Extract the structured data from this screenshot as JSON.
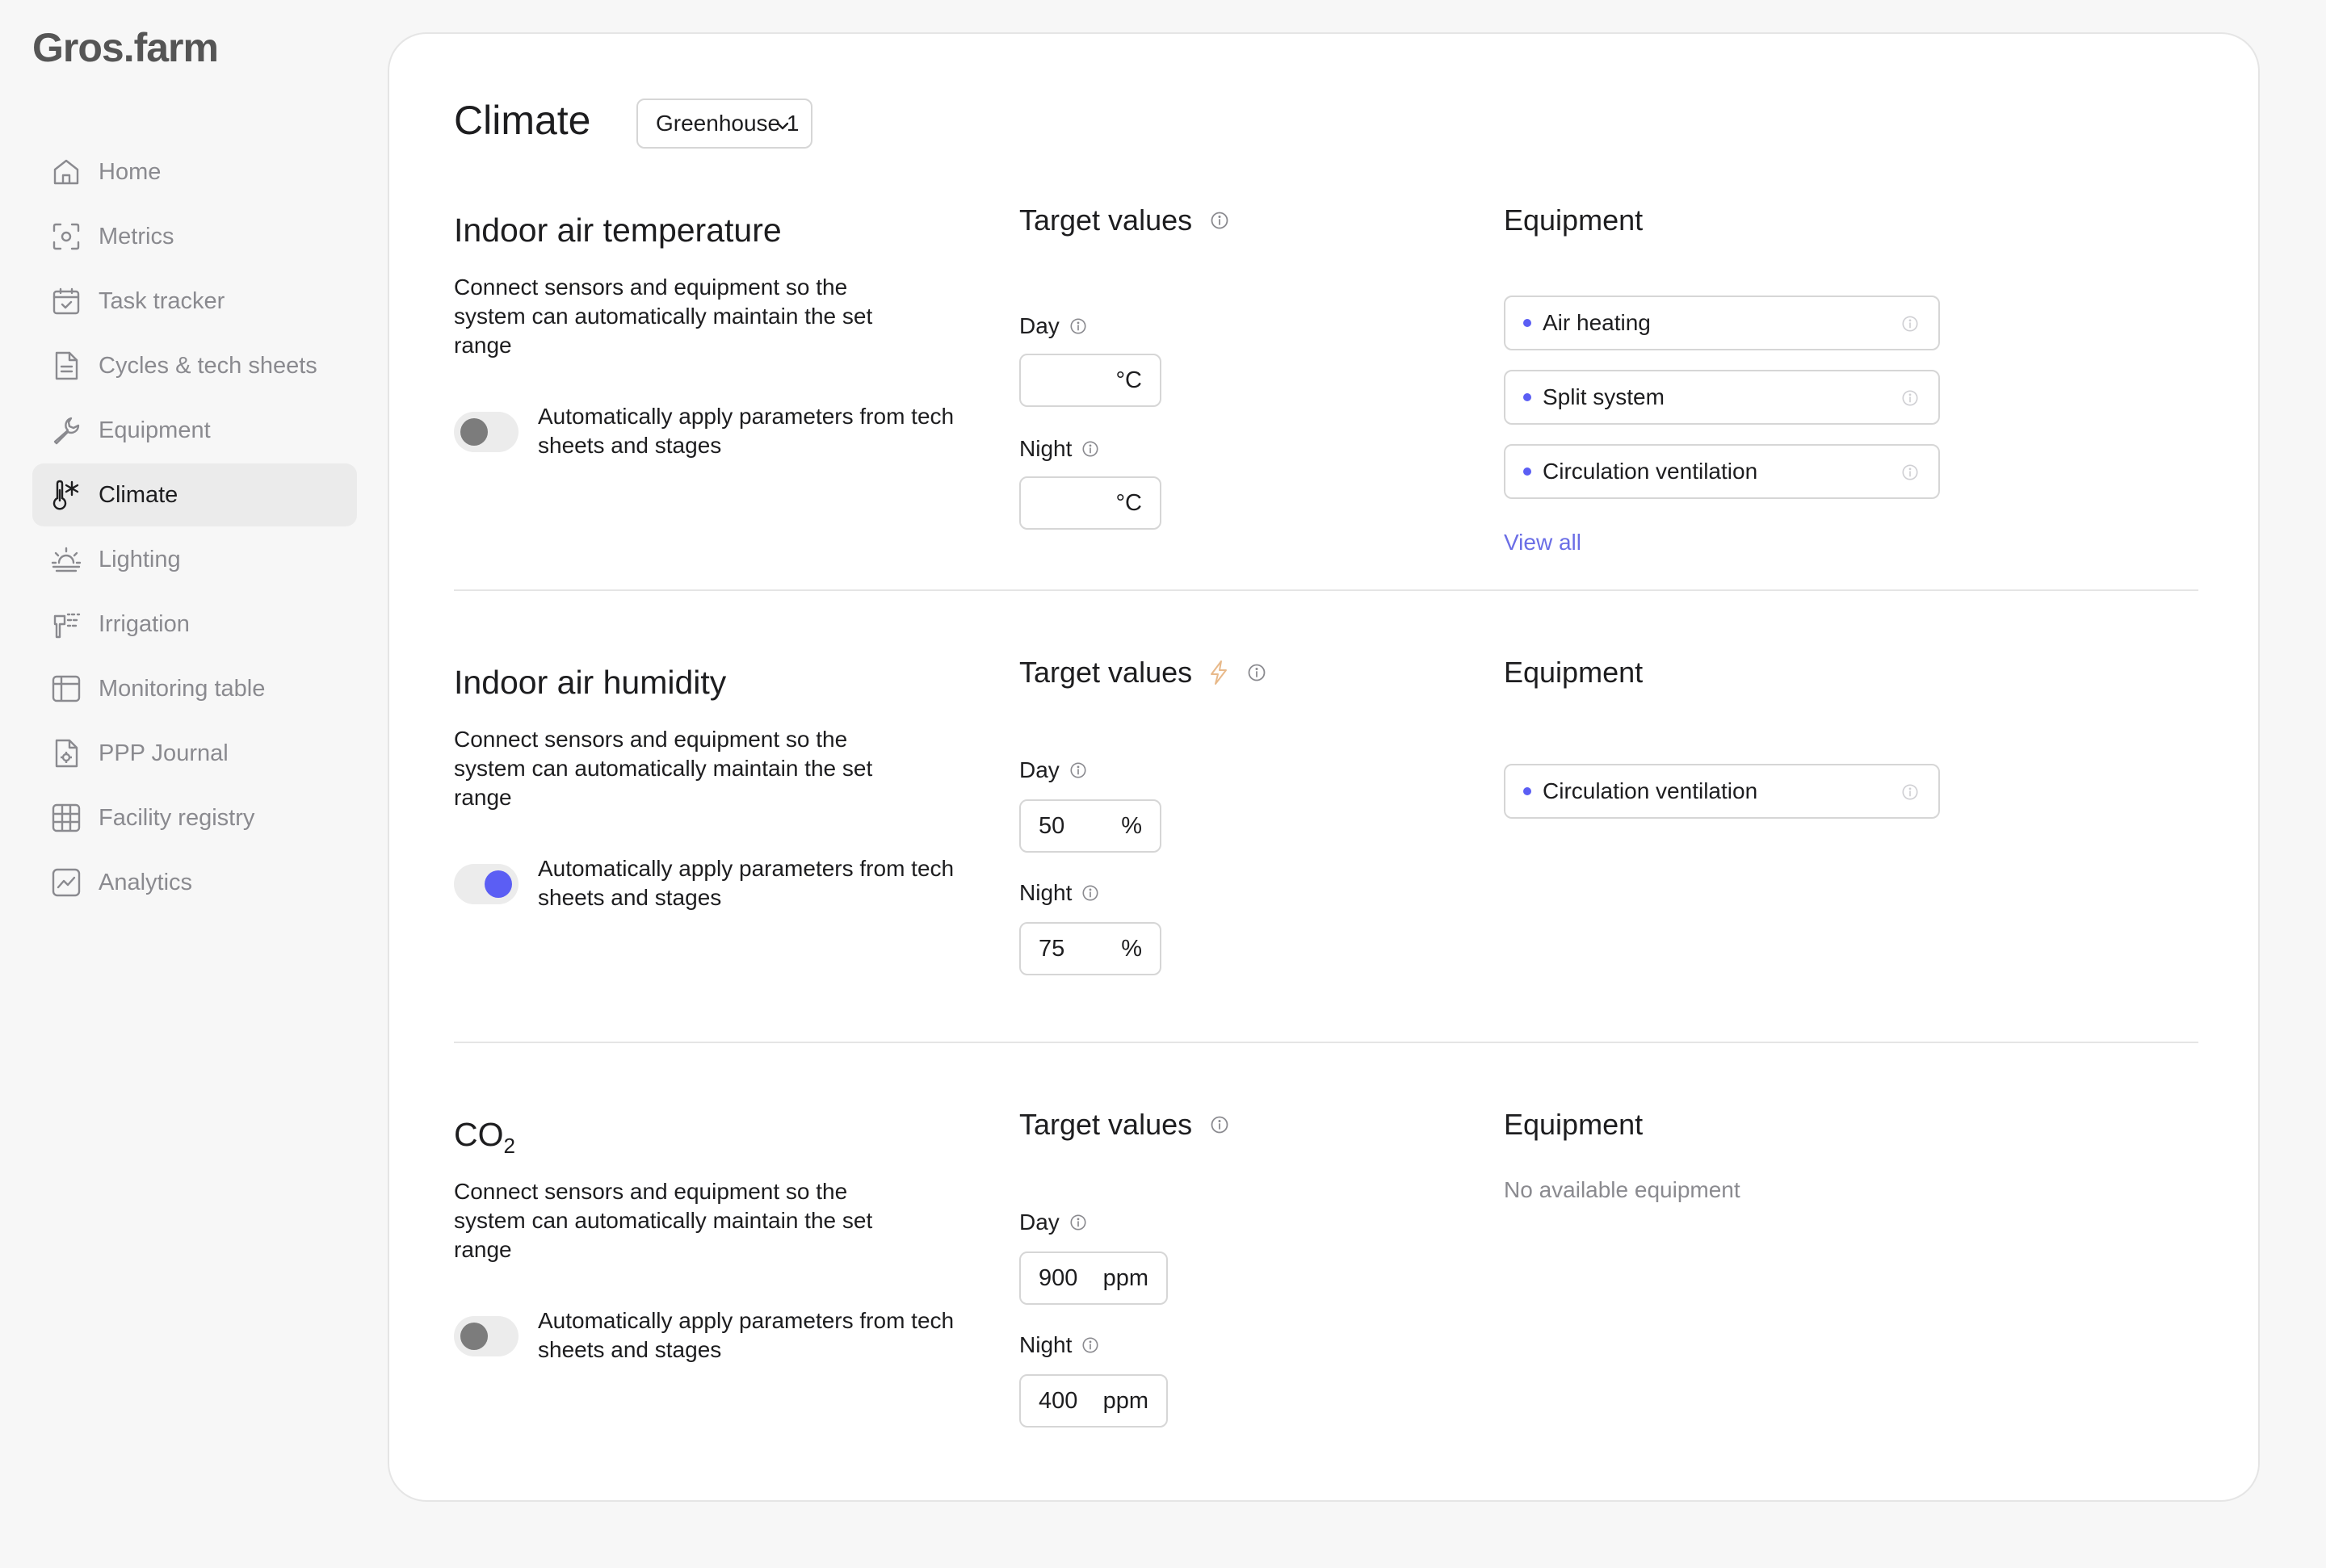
{
  "app": {
    "logo": "Gros.farm"
  },
  "sidebar": {
    "items": [
      {
        "label": "Home",
        "icon": "home-icon"
      },
      {
        "label": "Metrics",
        "icon": "metrics-icon"
      },
      {
        "label": "Task tracker",
        "icon": "calendar-check-icon"
      },
      {
        "label": "Cycles & tech sheets",
        "icon": "document-icon"
      },
      {
        "label": "Equipment",
        "icon": "wrench-icon"
      },
      {
        "label": "Climate",
        "icon": "thermometer-snow-icon",
        "active": true
      },
      {
        "label": "Lighting",
        "icon": "sunrise-icon"
      },
      {
        "label": "Irrigation",
        "icon": "sprinkler-icon"
      },
      {
        "label": "Monitoring table",
        "icon": "table-icon"
      },
      {
        "label": "PPP Journal",
        "icon": "journal-gear-icon"
      },
      {
        "label": "Facility registry",
        "icon": "grid-icon"
      },
      {
        "label": "Analytics",
        "icon": "chart-icon"
      }
    ]
  },
  "main": {
    "title": "Climate",
    "greenhouse_select": "Greenhouse 1",
    "sections": [
      {
        "title": "Indoor air temperature",
        "description": "Connect sensors and equipment so the system can automatically maintain the set range",
        "auto_toggle": {
          "label": "Automatically apply parameters from tech sheets and stages",
          "on": false
        },
        "target_values_title": "Target values",
        "day_label": "Day",
        "day_value": "",
        "day_unit": "°C",
        "night_label": "Night",
        "night_value": "",
        "night_unit": "°C",
        "equipment_title": "Equipment",
        "equipment": [
          "Air heating",
          "Split system",
          "Circulation ventilation"
        ],
        "view_all": "View all"
      },
      {
        "title": "Indoor air humidity",
        "description": "Connect sensors and equipment so the system can automatically maintain the set range",
        "auto_toggle": {
          "label": "Automatically apply parameters from tech sheets and stages",
          "on": true
        },
        "target_values_title": "Target values",
        "day_label": "Day",
        "day_value": "50",
        "day_unit": "%",
        "night_label": "Night",
        "night_value": "75",
        "night_unit": "%",
        "equipment_title": "Equipment",
        "equipment": [
          "Circulation ventilation"
        ]
      },
      {
        "title": "CO",
        "title_subscript": "2",
        "description": "Connect sensors and equipment so the system can automatically maintain the set range",
        "auto_toggle": {
          "label": "Automatically apply parameters from tech sheets and stages",
          "on": false
        },
        "target_values_title": "Target values",
        "day_label": "Day",
        "day_value": "900",
        "day_unit": "ppm",
        "night_label": "Night",
        "night_value": "400",
        "night_unit": "ppm",
        "equipment_title": "Equipment",
        "no_equipment": "No available equipment"
      }
    ]
  },
  "colors": {
    "accent": "#5b5ef4",
    "link": "#6b6ee6",
    "bolt": "#e8b98a",
    "muted_text": "#8a8a8f",
    "active_nav_bg": "#ebebeb"
  }
}
